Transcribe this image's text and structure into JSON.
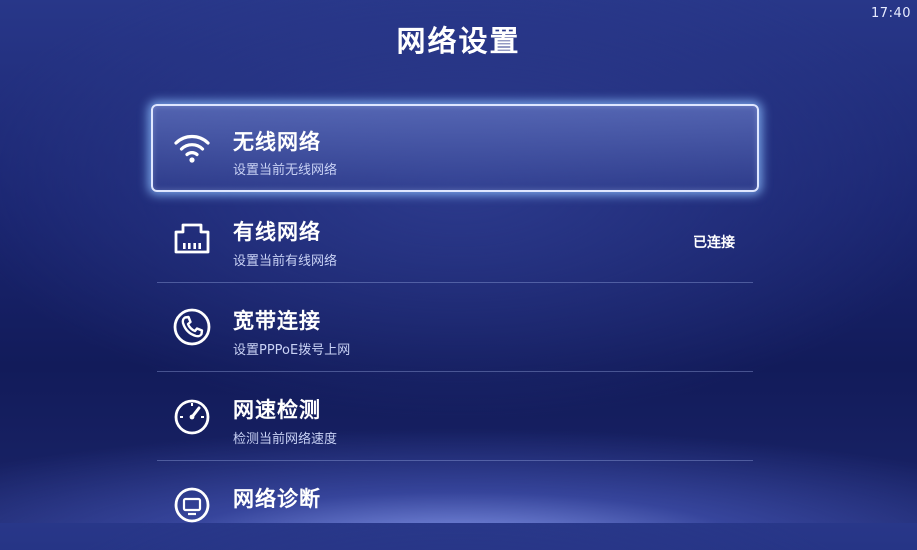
{
  "status_bar": {
    "time": "17:40"
  },
  "page": {
    "title": "网络设置"
  },
  "menu": {
    "items": [
      {
        "label": "无线网络",
        "subtitle": "设置当前无线网络",
        "status": "",
        "icon": "wifi-icon"
      },
      {
        "label": "有线网络",
        "subtitle": "设置当前有线网络",
        "status": "已连接",
        "icon": "ethernet-icon"
      },
      {
        "label": "宽带连接",
        "subtitle": "设置PPPoE拨号上网",
        "status": "",
        "icon": "phone-icon"
      },
      {
        "label": "网速检测",
        "subtitle": "检测当前网络速度",
        "status": "",
        "icon": "speedometer-icon"
      },
      {
        "label": "网络诊断",
        "subtitle": "",
        "status": "",
        "icon": "diagnose-icon"
      }
    ]
  }
}
